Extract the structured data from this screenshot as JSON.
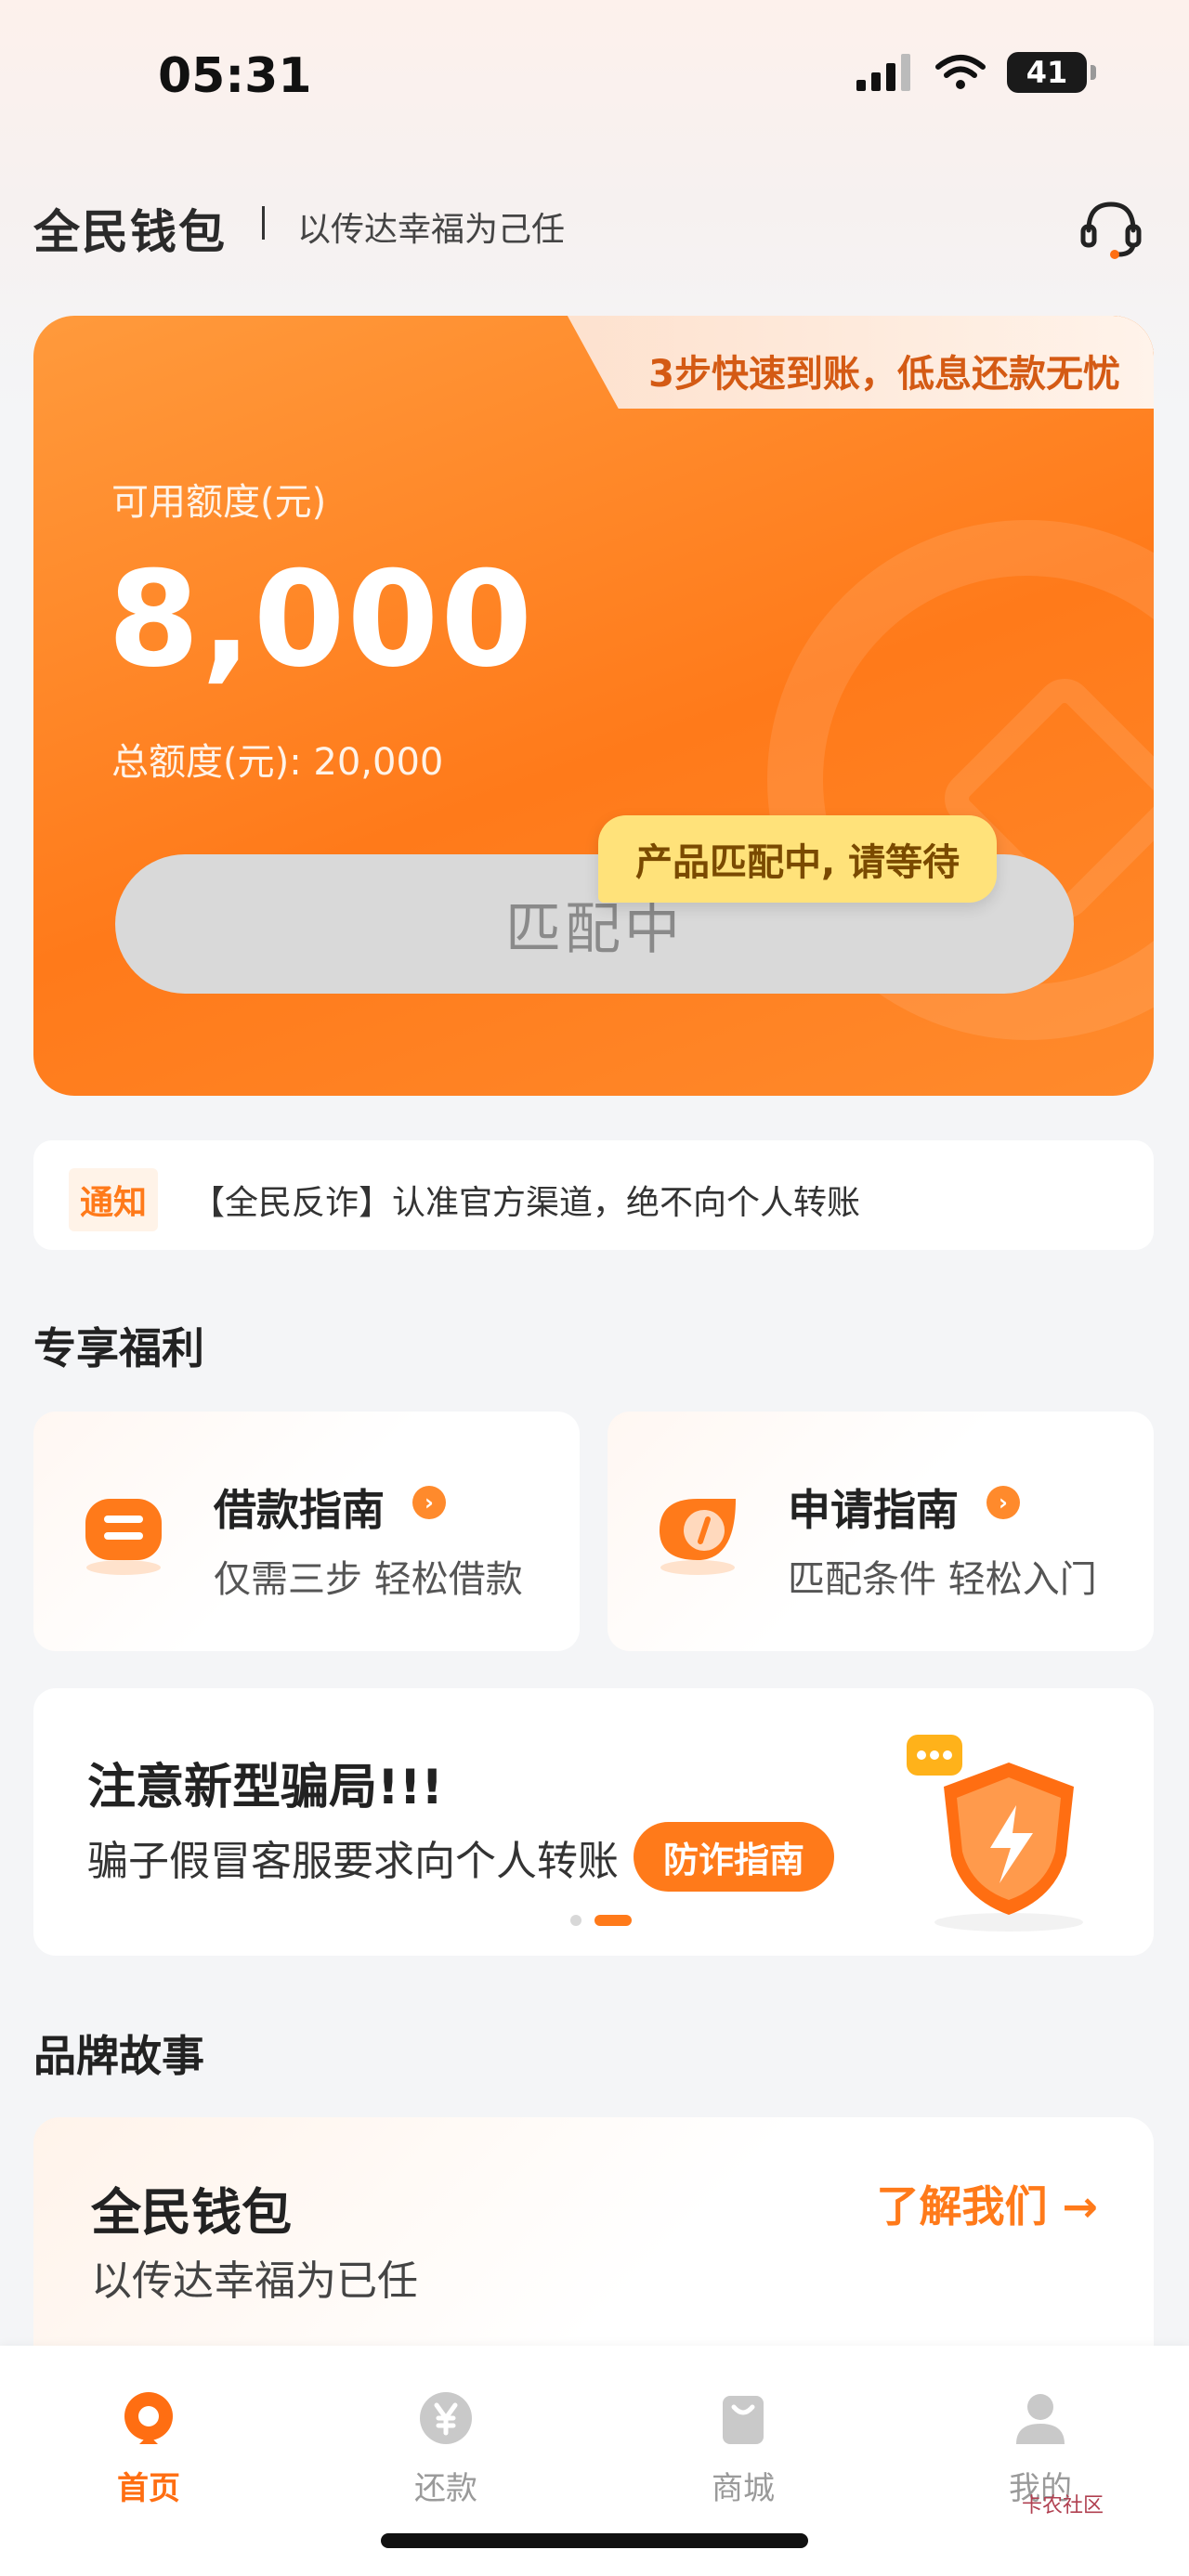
{
  "status": {
    "time": "05:31",
    "battery": "41"
  },
  "header": {
    "app_name": "全民钱包",
    "slogan": "以传达幸福为己任"
  },
  "hero": {
    "tab_text": "3步快速到账，低息还款无忧",
    "avail_label": "可用额度(元)",
    "amount": "8,000",
    "total": "总额度(元): 20,000",
    "button_label": "匹配中",
    "tip": "产品匹配中, 请等待"
  },
  "notice": {
    "badge": "通知",
    "text": "【全民反诈】认准官方渠道，绝不向个人转账"
  },
  "benefits": {
    "title": "专享福利",
    "cards": [
      {
        "title": "借款指南",
        "sub": "仅需三步 轻松借款"
      },
      {
        "title": "申请指南",
        "sub": "匹配条件 轻松入门"
      }
    ]
  },
  "banner": {
    "title": "注意新型骗局!!!",
    "sub": "骗子假冒客服要求向个人转账",
    "button": "防诈指南"
  },
  "brand": {
    "section_title": "品牌故事",
    "title": "全民钱包",
    "sub": "以传达幸福为已任",
    "link": "了解我们 →"
  },
  "tabbar": {
    "items": [
      {
        "label": "首页",
        "active": true
      },
      {
        "label": "还款"
      },
      {
        "label": "商城"
      },
      {
        "label": "我的"
      }
    ]
  },
  "watermark": "卡农社区",
  "colors": {
    "accent": "#ff7a1a",
    "accent_light": "#ff9a3c",
    "tip_bg": "#ffe27a"
  }
}
